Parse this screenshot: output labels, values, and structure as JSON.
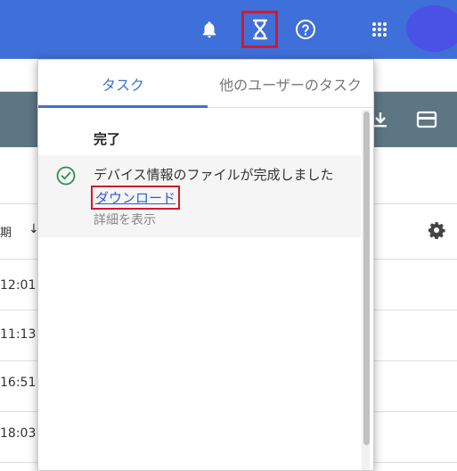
{
  "topbar": {
    "icons": [
      "bell-icon",
      "hourglass-icon",
      "help-icon",
      "apps-grid-icon"
    ],
    "highlight_color": "#d11a2a",
    "bar_color": "#3f6fd8"
  },
  "background_table": {
    "column_label": "期",
    "sort_icon": "↓",
    "times": [
      "12:01",
      "11:13",
      "16:51",
      "18:03"
    ]
  },
  "popover": {
    "tabs": [
      {
        "label": "タスク",
        "active": true
      },
      {
        "label": "他のユーザーのタスク",
        "active": false
      }
    ],
    "section_title": "完了",
    "task": {
      "status_icon": "check-circle-icon",
      "title": "デバイス情報のファイルが完成しました",
      "link_label": "ダウンロード",
      "detail_label": "詳細を表示"
    }
  }
}
